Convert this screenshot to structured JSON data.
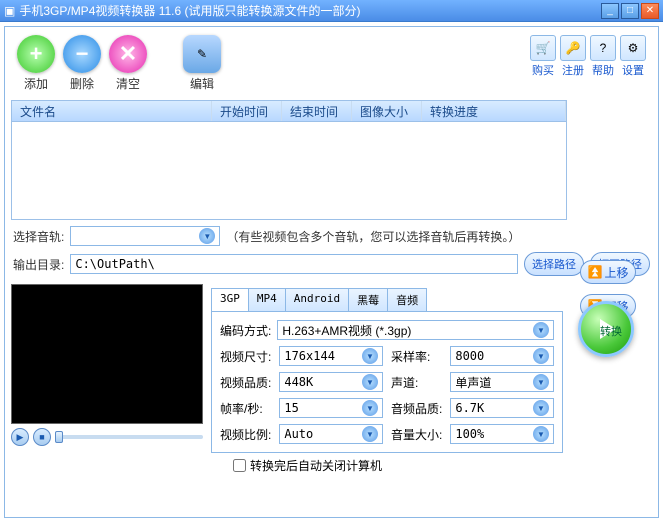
{
  "title": "手机3GP/MP4视频转换器 11.6 (试用版只能转换源文件的一部分)",
  "toolbar": {
    "add": "添加",
    "remove": "删除",
    "clear": "清空",
    "edit": "编辑",
    "buy": "购买",
    "register": "注册",
    "help": "帮助",
    "settings": "设置"
  },
  "columns": {
    "filename": "文件名",
    "start": "开始时间",
    "end": "结束时间",
    "imgsize": "图像大小",
    "progress": "转换进度"
  },
  "side": {
    "up": "上移",
    "down": "下移"
  },
  "audio": {
    "label": "选择音轨:",
    "hint": "（有些视频包含多个音轨，您可以选择音轨后再转换。）"
  },
  "output": {
    "label": "输出目录:",
    "value": "C:\\OutPath\\",
    "choose": "选择路径",
    "open": "打开路径"
  },
  "tabs": [
    "3GP",
    "MP4",
    "Android",
    "黑莓",
    "音频"
  ],
  "fields": {
    "encoding": {
      "label": "编码方式:",
      "value": "H.263+AMR视频 (*.3gp)"
    },
    "videosize": {
      "label": "视频尺寸:",
      "value": "176x144"
    },
    "samplerate": {
      "label": "采样率:",
      "value": "8000"
    },
    "videoquality": {
      "label": "视频品质:",
      "value": "448K"
    },
    "channel": {
      "label": "声道:",
      "value": "单声道"
    },
    "fps": {
      "label": "帧率/秒:",
      "value": "15"
    },
    "audioquality": {
      "label": "音频品质:",
      "value": "6.7K"
    },
    "aspect": {
      "label": "视频比例:",
      "value": "Auto"
    },
    "volume": {
      "label": "音量大小:",
      "value": "100%"
    }
  },
  "shutdown": "转换完后自动关闭计算机",
  "convert": "转换"
}
